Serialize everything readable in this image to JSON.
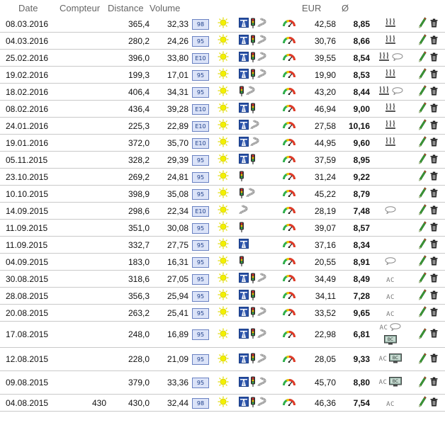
{
  "headers": {
    "date": "Date",
    "odometer": "Compteur",
    "distance": "Distance",
    "volume": "Volume",
    "eur": "EUR",
    "avg": "Ø"
  },
  "colors": {
    "fuel_badge_bg": "#dbe3f8",
    "fuel_badge_border": "#6a82c2",
    "sun": "#f3f000",
    "row_border": "#c9c9c9"
  },
  "icons": {
    "weather_sun": "sun-icon",
    "highway": "highway-icon",
    "city": "traffic-light-icon",
    "country": "road-curve-icon",
    "gauge": "speedometer-icon",
    "heating": "seat-heating-icon",
    "comment": "speech-bubble-icon",
    "bc": "bc-display-icon",
    "edit": "pencil-icon",
    "delete": "trash-icon"
  },
  "rows": [
    {
      "date": "08.03.2016",
      "odometer": "",
      "distance": "365,4",
      "volume": "32,33",
      "fuel": "98",
      "sun": true,
      "highway": true,
      "city": true,
      "country": true,
      "eur": "42,58",
      "avg": "8,85",
      "heat": true,
      "comment": false,
      "ac": "",
      "bc": false
    },
    {
      "date": "04.03.2016",
      "odometer": "",
      "distance": "280,2",
      "volume": "24,26",
      "fuel": "95",
      "sun": true,
      "highway": true,
      "city": true,
      "country": true,
      "eur": "30,76",
      "avg": "8,66",
      "heat": true,
      "comment": false,
      "ac": "",
      "bc": false
    },
    {
      "date": "25.02.2016",
      "odometer": "",
      "distance": "396,0",
      "volume": "33,80",
      "fuel": "E10",
      "sun": true,
      "highway": true,
      "city": true,
      "country": true,
      "eur": "39,55",
      "avg": "8,54",
      "heat": true,
      "comment": true,
      "ac": "",
      "bc": false
    },
    {
      "date": "19.02.2016",
      "odometer": "",
      "distance": "199,3",
      "volume": "17,01",
      "fuel": "95",
      "sun": true,
      "highway": true,
      "city": true,
      "country": true,
      "eur": "19,90",
      "avg": "8,53",
      "heat": true,
      "comment": false,
      "ac": "",
      "bc": false
    },
    {
      "date": "18.02.2016",
      "odometer": "",
      "distance": "406,4",
      "volume": "34,31",
      "fuel": "95",
      "sun": true,
      "highway": false,
      "city": true,
      "country": true,
      "eur": "43,20",
      "avg": "8,44",
      "heat": true,
      "comment": true,
      "ac": "",
      "bc": false
    },
    {
      "date": "08.02.2016",
      "odometer": "",
      "distance": "436,4",
      "volume": "39,28",
      "fuel": "E10",
      "sun": true,
      "highway": true,
      "city": true,
      "country": false,
      "eur": "46,94",
      "avg": "9,00",
      "heat": true,
      "comment": false,
      "ac": "",
      "bc": false
    },
    {
      "date": "24.01.2016",
      "odometer": "",
      "distance": "225,3",
      "volume": "22,89",
      "fuel": "E10",
      "sun": true,
      "highway": true,
      "city": false,
      "country": true,
      "eur": "27,58",
      "avg": "10,16",
      "heat": true,
      "comment": false,
      "ac": "",
      "bc": false
    },
    {
      "date": "19.01.2016",
      "odometer": "",
      "distance": "372,0",
      "volume": "35,70",
      "fuel": "E10",
      "sun": true,
      "highway": true,
      "city": false,
      "country": true,
      "eur": "44,95",
      "avg": "9,60",
      "heat": true,
      "comment": false,
      "ac": "",
      "bc": false
    },
    {
      "date": "05.11.2015",
      "odometer": "",
      "distance": "328,2",
      "volume": "29,39",
      "fuel": "95",
      "sun": true,
      "highway": true,
      "city": true,
      "country": false,
      "eur": "37,59",
      "avg": "8,95",
      "heat": false,
      "comment": false,
      "ac": "",
      "bc": false
    },
    {
      "date": "23.10.2015",
      "odometer": "",
      "distance": "269,2",
      "volume": "24,81",
      "fuel": "95",
      "sun": true,
      "highway": false,
      "city": true,
      "country": false,
      "eur": "31,24",
      "avg": "9,22",
      "heat": false,
      "comment": false,
      "ac": "",
      "bc": false
    },
    {
      "date": "10.10.2015",
      "odometer": "",
      "distance": "398,9",
      "volume": "35,08",
      "fuel": "95",
      "sun": true,
      "highway": false,
      "city": true,
      "country": true,
      "eur": "45,22",
      "avg": "8,79",
      "heat": false,
      "comment": false,
      "ac": "",
      "bc": false
    },
    {
      "date": "14.09.2015",
      "odometer": "",
      "distance": "298,6",
      "volume": "22,34",
      "fuel": "E10",
      "sun": true,
      "highway": false,
      "city": false,
      "country": true,
      "eur": "28,19",
      "avg": "7,48",
      "heat": false,
      "comment": true,
      "ac": "",
      "bc": false
    },
    {
      "date": "11.09.2015",
      "odometer": "",
      "distance": "351,0",
      "volume": "30,08",
      "fuel": "95",
      "sun": true,
      "highway": false,
      "city": true,
      "country": false,
      "eur": "39,07",
      "avg": "8,57",
      "heat": false,
      "comment": false,
      "ac": "",
      "bc": false
    },
    {
      "date": "11.09.2015",
      "odometer": "",
      "distance": "332,7",
      "volume": "27,75",
      "fuel": "95",
      "sun": true,
      "highway": true,
      "city": false,
      "country": false,
      "eur": "37,16",
      "avg": "8,34",
      "heat": false,
      "comment": false,
      "ac": "",
      "bc": false
    },
    {
      "date": "04.09.2015",
      "odometer": "",
      "distance": "183,0",
      "volume": "16,31",
      "fuel": "95",
      "sun": true,
      "highway": false,
      "city": true,
      "country": false,
      "eur": "20,55",
      "avg": "8,91",
      "heat": false,
      "comment": true,
      "ac": "",
      "bc": false
    },
    {
      "date": "30.08.2015",
      "odometer": "",
      "distance": "318,6",
      "volume": "27,05",
      "fuel": "95",
      "sun": true,
      "highway": true,
      "city": true,
      "country": true,
      "eur": "34,49",
      "avg": "8,49",
      "heat": false,
      "comment": false,
      "ac": "AC",
      "bc": false
    },
    {
      "date": "28.08.2015",
      "odometer": "",
      "distance": "356,3",
      "volume": "25,94",
      "fuel": "95",
      "sun": true,
      "highway": true,
      "city": true,
      "country": false,
      "eur": "34,11",
      "avg": "7,28",
      "heat": false,
      "comment": false,
      "ac": "AC",
      "bc": false
    },
    {
      "date": "20.08.2015",
      "odometer": "",
      "distance": "263,2",
      "volume": "25,41",
      "fuel": "95",
      "sun": true,
      "highway": true,
      "city": true,
      "country": true,
      "eur": "33,52",
      "avg": "9,65",
      "heat": false,
      "comment": false,
      "ac": "AC",
      "bc": false
    },
    {
      "date": "17.08.2015",
      "odometer": "",
      "distance": "248,0",
      "volume": "16,89",
      "fuel": "95",
      "sun": true,
      "highway": true,
      "city": true,
      "country": true,
      "eur": "22,98",
      "avg": "6,81",
      "heat": false,
      "comment": true,
      "ac": "AC",
      "bc": true
    },
    {
      "date": "12.08.2015",
      "odometer": "",
      "distance": "228,0",
      "volume": "21,09",
      "fuel": "95",
      "sun": true,
      "highway": true,
      "city": true,
      "country": true,
      "eur": "28,05",
      "avg": "9,33",
      "heat": false,
      "comment": false,
      "ac": "AC",
      "bc": true
    },
    {
      "date": "09.08.2015",
      "odometer": "",
      "distance": "379,0",
      "volume": "33,36",
      "fuel": "95",
      "sun": true,
      "highway": true,
      "city": true,
      "country": true,
      "eur": "45,70",
      "avg": "8,80",
      "heat": false,
      "comment": false,
      "ac": "AC",
      "bc": true
    },
    {
      "date": "04.08.2015",
      "odometer": "430",
      "distance": "430,0",
      "volume": "32,44",
      "fuel": "98",
      "sun": true,
      "highway": true,
      "city": true,
      "country": true,
      "eur": "46,36",
      "avg": "7,54",
      "heat": false,
      "comment": false,
      "ac": "AC",
      "bc": false
    }
  ],
  "bc_label": "BC"
}
